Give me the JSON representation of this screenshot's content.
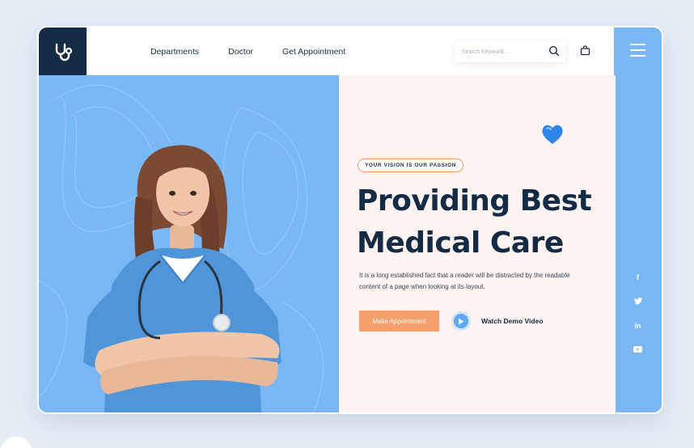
{
  "nav": {
    "items": [
      "Departments",
      "Doctor",
      "Get Appointment"
    ]
  },
  "search": {
    "placeholder": "Search Keyword..."
  },
  "hero": {
    "tag": "YOUR VISION IS OUR PASSION",
    "headline_line1": "Providing Best",
    "headline_line2": "Medical Care",
    "description": "It is a long established fact that a reader will be distracted by the readable content of a page when looking at its layout.",
    "cta_label": "Make Appointment",
    "video_label": "Watch Demo Video"
  },
  "social": {
    "facebook": "f",
    "linkedin": "in"
  },
  "colors": {
    "navy": "#132b44",
    "sky_blue": "#7ab8f5",
    "accent_orange": "#f6a06e",
    "hero_bg": "#fdf3f1"
  }
}
